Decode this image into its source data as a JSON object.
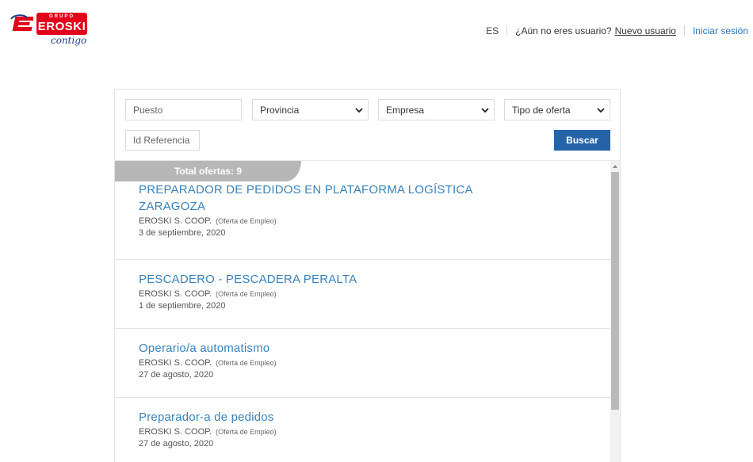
{
  "brand": {
    "group_label": "GRUPO",
    "name": "EROSKI",
    "tagline": "contigo",
    "red": "#e2001a",
    "blue": "#1d3e8f"
  },
  "topnav": {
    "language": "ES",
    "question": "¿Aún no eres usuario?",
    "register_link": "Nuevo usuario",
    "login_link": "Iniciar sesión"
  },
  "search": {
    "puesto_placeholder": "Puesto",
    "provincia": "Provincia",
    "empresa": "Empresa",
    "tipo_oferta": "Tipo de oferta",
    "referencia_placeholder": "Id Referencia",
    "submit_label": "Buscar",
    "accent": "#2563a9"
  },
  "results": {
    "total_label": "Total ofertas: 9",
    "items": [
      {
        "title_line1": "PREPARADOR DE PEDIDOS EN PLATAFORMA LOGÍSTICA",
        "title_line2": "ZARAGOZA",
        "company": "EROSKI S. COOP.",
        "kind": "(Oferta de Empleo)",
        "date": "3 de septiembre, 2020"
      },
      {
        "title_line1": "PESCADERO - PESCADERA PERALTA",
        "company": "EROSKI S. COOP.",
        "kind": "(Oferta de Empleo)",
        "date": "1 de septiembre, 2020"
      },
      {
        "title_line1": "Operario/a automatismo",
        "company": "EROSKI S. COOP.",
        "kind": "(Oferta de Empleo)",
        "date": "27 de agosto, 2020"
      },
      {
        "title_line1": "Preparador-a de pedidos",
        "company": "EROSKI S. COOP.",
        "kind": "(Oferta de Empleo)",
        "date": "27 de agosto, 2020"
      }
    ]
  }
}
